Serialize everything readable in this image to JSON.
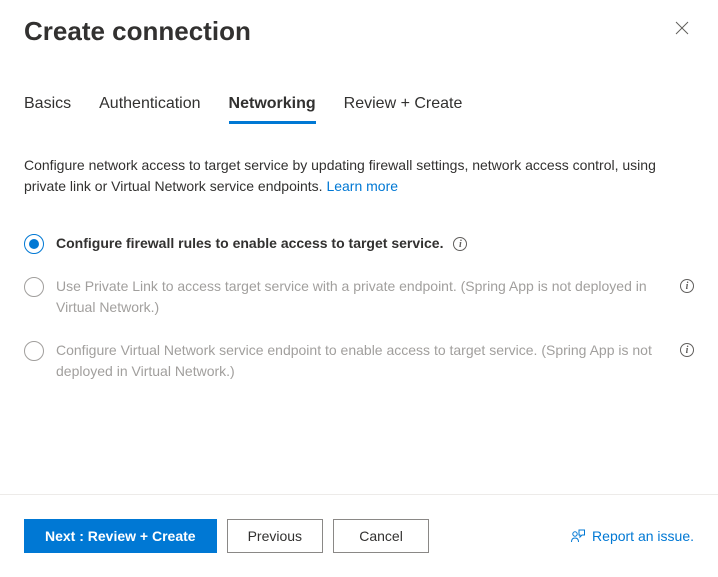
{
  "header": {
    "title": "Create connection"
  },
  "tabs": [
    {
      "label": "Basics",
      "active": false
    },
    {
      "label": "Authentication",
      "active": false
    },
    {
      "label": "Networking",
      "active": true
    },
    {
      "label": "Review + Create",
      "active": false
    }
  ],
  "description": {
    "text": "Configure network access to target service by updating firewall settings, network access control, using private link or Virtual Network service endpoints.",
    "learn_more": "Learn more"
  },
  "options": [
    {
      "label": "Configure firewall rules to enable access to target service.",
      "selected": true,
      "disabled": false,
      "info": true,
      "info_inline": true
    },
    {
      "label": "Use Private Link to access target service with a private endpoint. (Spring App is not deployed in Virtual Network.)",
      "selected": false,
      "disabled": true,
      "info": true,
      "info_inline": false
    },
    {
      "label": "Configure Virtual Network service endpoint to enable access to target service. (Spring App is not deployed in Virtual Network.)",
      "selected": false,
      "disabled": true,
      "info": true,
      "info_inline": false
    }
  ],
  "footer": {
    "next": "Next : Review + Create",
    "previous": "Previous",
    "cancel": "Cancel",
    "report": "Report an issue."
  }
}
